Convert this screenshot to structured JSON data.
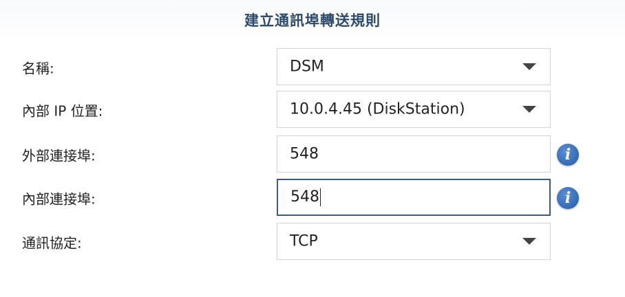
{
  "dialog": {
    "title": "建立通訊埠轉送規則"
  },
  "form": {
    "name": {
      "label": "名稱:",
      "value": "DSM"
    },
    "internal_ip": {
      "label": "內部 IP 位置:",
      "value": "10.0.4.45 (DiskStation)"
    },
    "external_port": {
      "label": "外部連接埠:",
      "value": "548"
    },
    "internal_port": {
      "label": "內部連接埠:",
      "value": "548"
    },
    "protocol": {
      "label": "通訊協定:",
      "value": "TCP"
    }
  },
  "icons": {
    "dropdown": "chevron-down-icon",
    "info": "info-icon",
    "info_glyph": "i"
  },
  "colors": {
    "title": "#2c4a6b",
    "focus_border": "#3a5a80",
    "info_icon": "#1f5aa8"
  }
}
